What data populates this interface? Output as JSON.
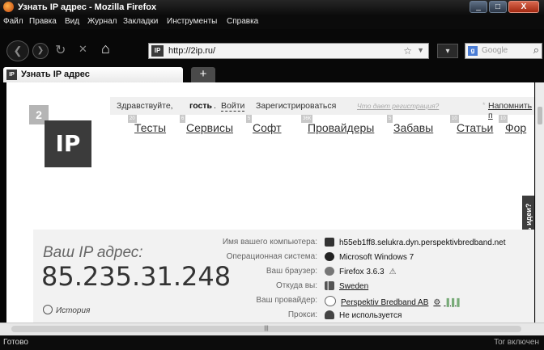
{
  "window": {
    "title": "Узнать IP адрес - Mozilla Firefox",
    "minimize": "_",
    "maximize": "□",
    "close": "X"
  },
  "menu": [
    "Файл",
    "Правка",
    "Вид",
    "Журнал",
    "Закладки",
    "Инструменты",
    "Справка"
  ],
  "nav": {
    "url": "http://2ip.ru/",
    "search_placeholder": "Google",
    "site_icon": "IP"
  },
  "tab": {
    "title": "Узнать IP адрес",
    "icon": "IP",
    "new_tab": "+"
  },
  "site": {
    "logo_small": "2",
    "logo_big": "IP",
    "greeting": "Здравствуйте,",
    "guest": "гость",
    "login": "Войти",
    "register": "Зарегистрироваться",
    "why_register": "Что дает регистрация?",
    "remind": "Напомнить п",
    "nav_items": [
      {
        "label": "Тесты",
        "badge": "20"
      },
      {
        "label": "Сервисы",
        "badge": "6"
      },
      {
        "label": "Софт",
        "badge": "5"
      },
      {
        "label": "Провайдеры",
        "badge": "36К"
      },
      {
        "label": "Забавы",
        "badge": "5"
      },
      {
        "label": "Статьи",
        "badge": "10"
      },
      {
        "label": "Фор",
        "badge": "10"
      }
    ],
    "ideas_tab": "Есть идеи?",
    "ip_caption": "Ваш IP адрес:",
    "ip_value": "85.235.31.248",
    "history": "История",
    "info": [
      {
        "label": "Имя вашего компьютера:",
        "value": "h55eb1ff8.selukra.dyn.perspektivbredband.net",
        "icon": "computer-icon",
        "link": false
      },
      {
        "label": "Операционная система:",
        "value": "Microsoft Windows 7",
        "icon": "windows-icon",
        "link": false
      },
      {
        "label": "Ваш браузер:",
        "value": "Firefox 3.6.3",
        "icon": "firefox-icon",
        "link": false
      },
      {
        "label": "Откуда вы:",
        "value": "Sweden",
        "icon": "flag-icon",
        "link": true
      },
      {
        "label": "Ваш провайдер:",
        "value": "Perspektiv Bredband AB",
        "icon": "provider-icon",
        "link": true
      },
      {
        "label": "Прокси:",
        "value": "Не используется",
        "icon": "spy-icon",
        "link": false
      }
    ]
  },
  "status": {
    "left": "Готово",
    "right": "Tor включен"
  },
  "colors": {
    "bg": "#0b0b0b",
    "panel": "#f2f2f2",
    "dark_logo": "#3b3b3b"
  }
}
